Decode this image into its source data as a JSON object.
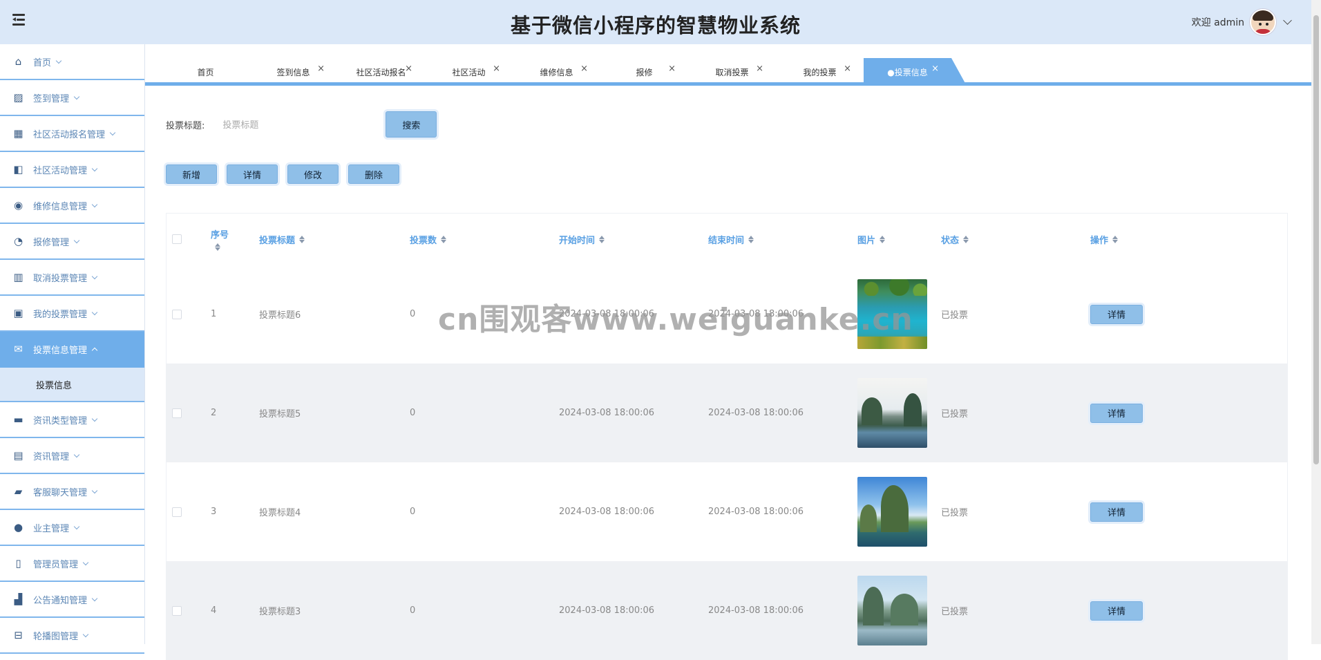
{
  "header": {
    "title": "基于微信小程序的智慧物业系统",
    "welcome": "欢迎 admin"
  },
  "sidebar": {
    "items": [
      {
        "label": "首页",
        "icon": "home-icon"
      },
      {
        "label": "签到管理",
        "icon": "picture-icon"
      },
      {
        "label": "社区活动报名管理",
        "icon": "grid-icon"
      },
      {
        "label": "社区活动管理",
        "icon": "panel-icon"
      },
      {
        "label": "维修信息管理",
        "icon": "disc-icon"
      },
      {
        "label": "报修管理",
        "icon": "gauge-icon"
      },
      {
        "label": "取消投票管理",
        "icon": "building-icon"
      },
      {
        "label": "我的投票管理",
        "icon": "image-icon"
      },
      {
        "label": "投票信息管理",
        "icon": "mail-icon",
        "active": true
      },
      {
        "label": "资讯类型管理",
        "icon": "ticket-icon"
      },
      {
        "label": "资讯管理",
        "icon": "news-icon"
      },
      {
        "label": "客服聊天管理",
        "icon": "briefcase-icon"
      },
      {
        "label": "业主管理",
        "icon": "drop-icon"
      },
      {
        "label": "管理员管理",
        "icon": "book-icon"
      },
      {
        "label": "公告通知管理",
        "icon": "chart-icon"
      },
      {
        "label": "轮播图管理",
        "icon": "slider-icon"
      }
    ],
    "submenu": "投票信息"
  },
  "tabs": [
    {
      "label": "首页",
      "closable": false
    },
    {
      "label": "签到信息",
      "closable": true
    },
    {
      "label": "社区活动报名",
      "closable": true
    },
    {
      "label": "社区活动",
      "closable": true
    },
    {
      "label": "维修信息",
      "closable": true
    },
    {
      "label": "报修",
      "closable": true
    },
    {
      "label": "取消投票",
      "closable": true
    },
    {
      "label": "我的投票",
      "closable": true
    },
    {
      "label": "●投票信息",
      "closable": true,
      "active": true
    }
  ],
  "search": {
    "label": "投票标题:",
    "placeholder": "投票标题",
    "button": "搜索"
  },
  "actions": {
    "add": "新增",
    "detail": "详情",
    "edit": "修改",
    "delete": "删除"
  },
  "table": {
    "columns": {
      "index": "序号",
      "title": "投票标题",
      "count": "投票数",
      "start": "开始时间",
      "end": "结束时间",
      "image": "图片",
      "status": "状态",
      "operation": "操作"
    },
    "rows": [
      {
        "index": "1",
        "title": "投票标题6",
        "count": "0",
        "start": "2024-03-08 18:00:06",
        "end": "2024-03-08 18:00:06",
        "image": "lake",
        "status": "已投票",
        "op": "详情"
      },
      {
        "index": "2",
        "title": "投票标题5",
        "count": "0",
        "start": "2024-03-08 18:00:06",
        "end": "2024-03-08 18:00:06",
        "image": "karst1",
        "status": "已投票",
        "op": "详情"
      },
      {
        "index": "3",
        "title": "投票标题4",
        "count": "0",
        "start": "2024-03-08 18:00:06",
        "end": "2024-03-08 18:00:06",
        "image": "karst2",
        "status": "已投票",
        "op": "详情"
      },
      {
        "index": "4",
        "title": "投票标题3",
        "count": "0",
        "start": "2024-03-08 18:00:06",
        "end": "2024-03-08 18:00:06",
        "image": "karst3",
        "status": "已投票",
        "op": "详情"
      }
    ]
  },
  "watermark": "cn围观客www.weiguanke.cn",
  "colors": {
    "accent": "#6faeea",
    "header_bg": "#dbe8f8",
    "button_bg": "#8fbfe8"
  }
}
